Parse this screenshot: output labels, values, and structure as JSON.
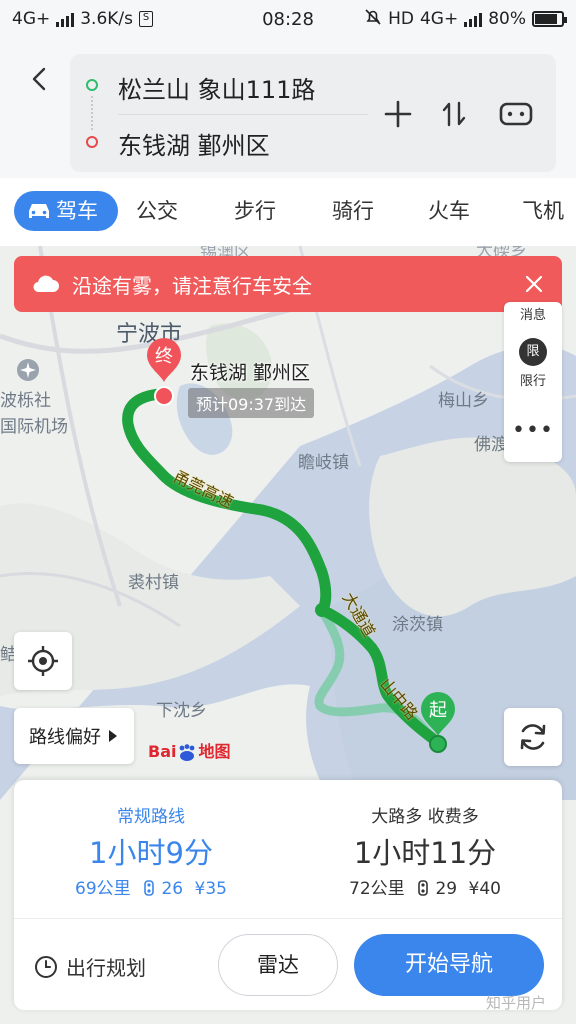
{
  "status_bar": {
    "network": "4G+",
    "speed": "3.6K/s",
    "time": "08:28",
    "hd": "HD",
    "network2": "4G+",
    "battery": "80%"
  },
  "route": {
    "start": "松兰山 象山111路",
    "end": "东钱湖 鄞州区"
  },
  "tabs": [
    "驾车",
    "公交",
    "步行",
    "骑行",
    "火车",
    "飞机"
  ],
  "alert": {
    "text": "沿途有雾，请注意行车安全"
  },
  "map": {
    "labels": {
      "top_cut": "锡澳区",
      "top_right_cut": "大碶乡",
      "city": "宁波市",
      "airport_1": "波栎社",
      "airport_2": "国际机场",
      "meishan": "梅山乡",
      "fo": "佛渡",
      "zhanqi": "瞻岐镇",
      "peicun": "裘村镇",
      "tuci": "涂茨镇",
      "xiashen": "下沈乡",
      "left_cut": "鲒"
    },
    "road_labels": [
      "甬莞高速",
      "大通道",
      "山中路"
    ],
    "end_marker_label": "终",
    "start_marker_label": "起",
    "destination_label": "东钱湖 鄞州区",
    "eta": "预计09:37到达",
    "side_panel": {
      "top_cut": "消息",
      "limit_icon": "限",
      "limit_label": "限行",
      "more": "•••"
    },
    "route_preference": "路线偏好",
    "baidu_logo_a": "Bai",
    "baidu_logo_b": "地图"
  },
  "routes": [
    {
      "tag": "常规路线",
      "duration": "1小时9分",
      "distance": "69公里",
      "lights": "26",
      "fee": "¥35"
    },
    {
      "tag": "大路多 收费多",
      "duration": "1小时11分",
      "distance": "72公里",
      "lights": "29",
      "fee": "¥40"
    }
  ],
  "actions": {
    "plan": "出行规划",
    "radar": "雷达",
    "navigate": "开始导航"
  },
  "watermark": "知乎用户",
  "colors": {
    "accent": "#3a86ec",
    "alert": "#f05a5a",
    "route_main": "#2ea84a",
    "route_alt": "#86cdb0"
  }
}
